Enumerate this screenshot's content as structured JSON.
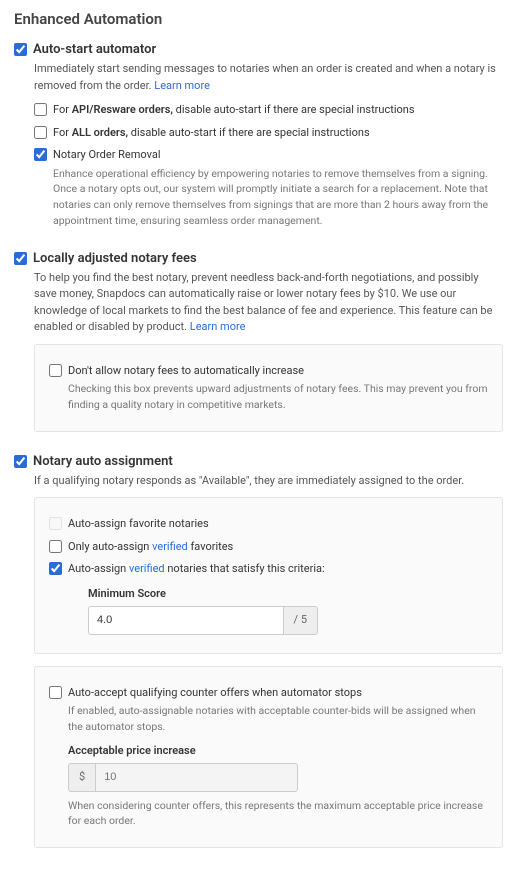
{
  "page_title": "Enhanced Automation",
  "auto_start": {
    "checked": true,
    "title": "Auto-start automator",
    "desc_prefix": "Immediately start sending messages to notaries when an order is created and when a notary is removed from the order. ",
    "learn_more": "Learn more",
    "opt_api": {
      "checked": false,
      "prefix": "For ",
      "strong": "API/Resware orders,",
      "rest": " disable auto-start if there are special instructions"
    },
    "opt_all": {
      "checked": false,
      "prefix": "For ",
      "strong": "ALL orders,",
      "rest": " disable auto-start if there are special instructions"
    },
    "opt_removal": {
      "checked": true,
      "title": "Notary Order Removal",
      "desc": "Enhance operational efficiency by empowering notaries to remove themselves from a signing. Once a notary opts out, our system will promptly initiate a search for a replacement. Note that notaries can only remove themselves from signings that are more than 2 hours away from the appointment time, ensuring seamless order management."
    }
  },
  "fees": {
    "checked": true,
    "title": "Locally adjusted notary fees",
    "desc_prefix": "To help you find the best notary, prevent needless back-and-forth negotiations, and possibly save money, Snapdocs can automatically raise or lower notary fees by $10. We use our knowledge of local markets to find the best balance of fee and experience. This feature can be enabled or disabled by product. ",
    "learn_more": "Learn more",
    "no_increase": {
      "checked": false,
      "title": "Don't allow notary fees to automatically increase",
      "desc": "Checking this box prevents upward adjustments of notary fees. This may prevent you from finding a quality notary in competitive markets."
    }
  },
  "auto_assign": {
    "checked": true,
    "title": "Notary auto assignment",
    "desc": "If a qualifying notary responds as \"Available\", they are immediately assigned to the order.",
    "fav": {
      "checked": false,
      "label": "Auto-assign favorite notaries"
    },
    "fav_verified": {
      "checked": false,
      "prefix": "Only auto-assign ",
      "link": "verified",
      "rest": " favorites"
    },
    "criteria": {
      "checked": true,
      "prefix": "Auto-assign ",
      "link": "verified",
      "rest": " notaries that satisfy this criteria:",
      "min_score_label": "Minimum Score",
      "min_score_value": "4.0",
      "min_score_suffix": "/ 5"
    },
    "counter": {
      "checked": false,
      "title": "Auto-accept qualifying counter offers when automator stops",
      "desc": "If enabled, auto-assignable notaries with acceptable counter-bids will be assigned when the automator stops.",
      "price_label": "Acceptable price increase",
      "price_prefix": "$",
      "price_placeholder": "10",
      "price_note": "When considering counter offers, this represents the maximum acceptable price increase for each order."
    }
  }
}
